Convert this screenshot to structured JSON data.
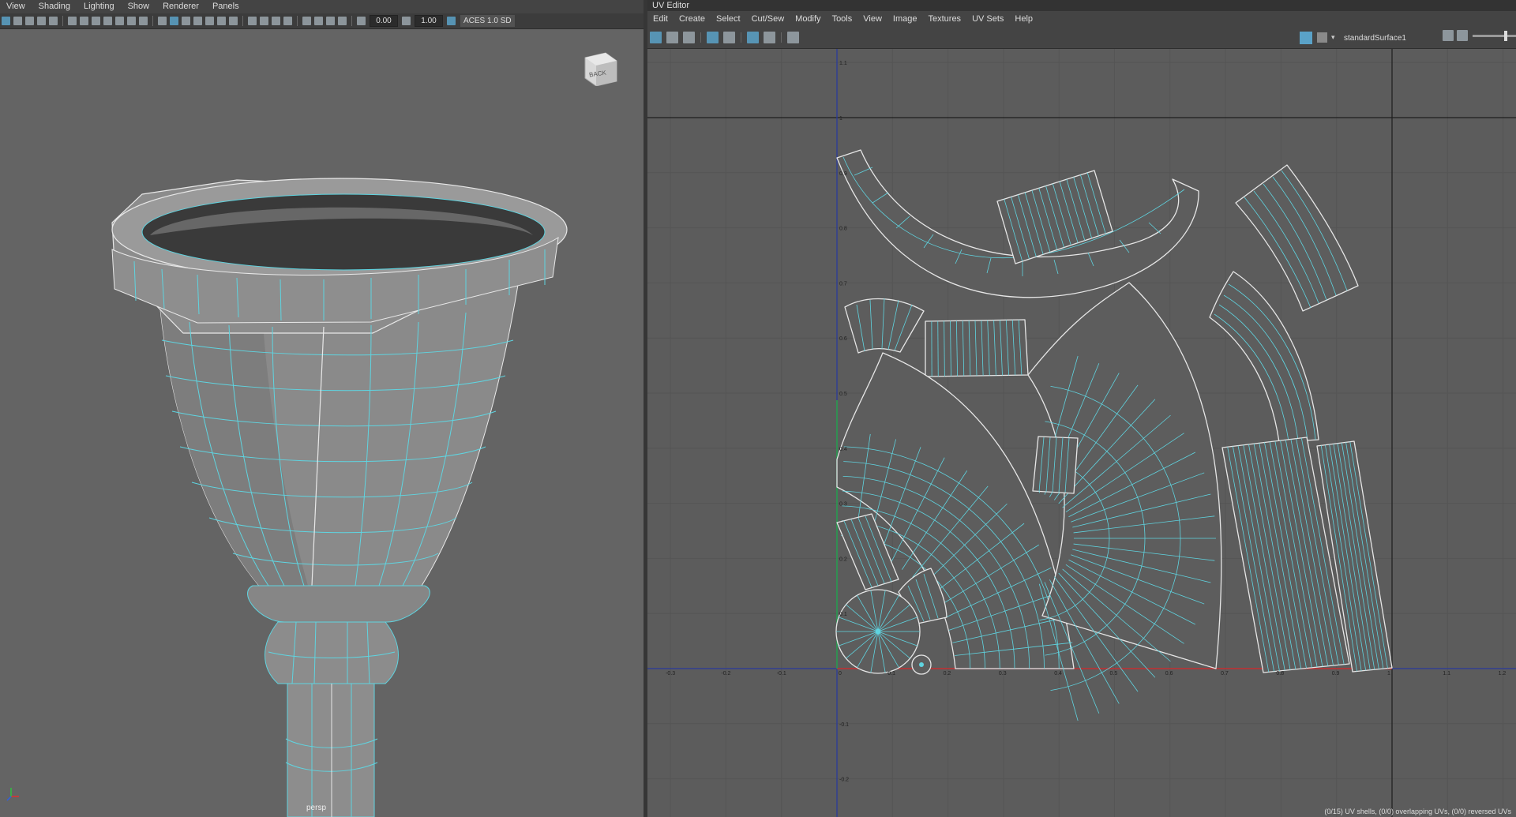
{
  "viewport": {
    "menu": [
      "View",
      "Shading",
      "Lighting",
      "Show",
      "Renderer",
      "Panels"
    ],
    "exposure": "0.00",
    "gamma": "1.00",
    "color_space": "ACES 1.0 SD",
    "viewcube_face": "BACK",
    "camera": "persp"
  },
  "uv_editor": {
    "title": "UV Editor",
    "menu": [
      "Edit",
      "Create",
      "Select",
      "Cut/Sew",
      "Modify",
      "Tools",
      "View",
      "Image",
      "Textures",
      "UV Sets",
      "Help"
    ],
    "shader": "standardSurface1",
    "status": "(0/15) UV shells, (0/0) overlapping UVs, (0/0) reversed UVs",
    "u_ticks": [
      "-0.3",
      "-0.2",
      "-0.1",
      "0",
      "0.1",
      "0.2",
      "0.3",
      "0.4",
      "0.5",
      "0.6",
      "0.7",
      "0.8",
      "0.9",
      "1",
      "1.1",
      "1.2"
    ],
    "v_ticks": [
      "1.1",
      "1",
      "0.9",
      "0.8",
      "0.7",
      "0.6",
      "0.5",
      "0.4",
      "0.3",
      "0.2",
      "0.1",
      "-0.1",
      "-0.2"
    ]
  },
  "colors": {
    "wire": "#5fd4e0",
    "u_axis": "#c8322c",
    "v_axis": "#2aa24a",
    "grid_blue": "#2a3a9a"
  }
}
